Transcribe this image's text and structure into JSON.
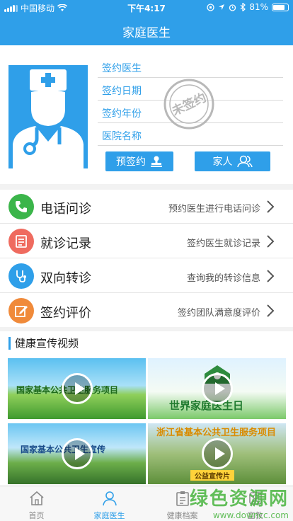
{
  "status_bar": {
    "carrier": "中国移动",
    "time": "下午4:17",
    "battery": "81%",
    "battery_level": 0.81
  },
  "header": {
    "title": "家庭医生"
  },
  "profile": {
    "fields": [
      "签约医生",
      "签约日期",
      "签约年份",
      "医院名称"
    ],
    "stamp_text": "未签约",
    "pre_sign_label": "预签约",
    "family_label": "家人"
  },
  "services": [
    {
      "name": "电话问诊",
      "desc": "预约医生进行电话问诊",
      "icon": "phone-icon",
      "color": "#3bb54a"
    },
    {
      "name": "就诊记录",
      "desc": "签约医生就诊记录",
      "icon": "record-icon",
      "color": "#ef6b5f"
    },
    {
      "name": "双向转诊",
      "desc": "查询我的转诊信息",
      "icon": "stethoscope-icon",
      "color": "#2f9fe9"
    },
    {
      "name": "签约评价",
      "desc": "签约团队满意度评价",
      "icon": "edit-icon",
      "color": "#f08a3a"
    }
  ],
  "videos": {
    "section_title": "健康宣传视频",
    "items": [
      {
        "caption": "国家基本公共卫生服务项目"
      },
      {
        "caption": "世界家庭医生日"
      },
      {
        "caption": "国家基本公共卫生宣传"
      },
      {
        "caption": "浙江省基本公共卫生服务项目",
        "subcaption": "公益宣传片"
      }
    ]
  },
  "tabs": [
    {
      "label": "首页",
      "icon": "home-icon"
    },
    {
      "label": "家庭医生",
      "icon": "person-icon",
      "active": true
    },
    {
      "label": "健康档案",
      "icon": "clipboard-icon"
    },
    {
      "label": "宣教",
      "icon": "education-icon"
    }
  ],
  "watermark": {
    "title": "绿色资源网",
    "url": "www.downcc.com"
  }
}
